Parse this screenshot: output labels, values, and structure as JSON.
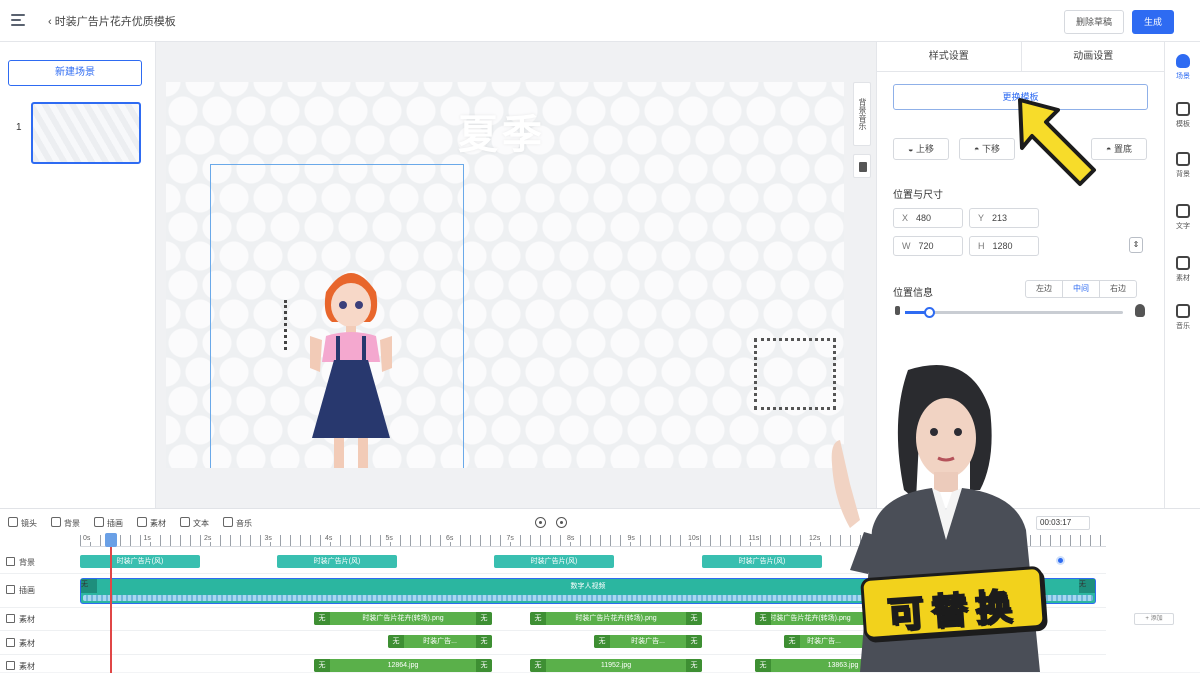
{
  "topbar": {
    "back_title": "时装广告片花卉优质模板",
    "exit_label": "删除草稿",
    "generate_label": "生成"
  },
  "left": {
    "new_scene": "新建场景",
    "scene_index": "1"
  },
  "canvas": {
    "title": "夏季",
    "side_tool": "背景音乐",
    "colors": {
      "accent": "#2e6bf2",
      "selection": "#6aa9e9"
    }
  },
  "panel": {
    "tabs": [
      "样式设置",
      "动画设置"
    ],
    "replace_label": "更换模板",
    "layer": {
      "up": "上移",
      "down": "下移",
      "bottom": "置底"
    },
    "pos_size_title": "位置与尺寸",
    "x_label": "X",
    "x_value": "480",
    "y_label": "Y",
    "y_value": "213",
    "w_label": "W",
    "w_value": "720",
    "h_label": "H",
    "h_value": "1280",
    "position_title": "位置信息",
    "align": {
      "left": "左边",
      "center": "中间",
      "right": "右边"
    },
    "slider_level": 0.11
  },
  "rail": [
    {
      "label": "场景",
      "icon": "person-icon"
    },
    {
      "label": "模板",
      "icon": "template-icon"
    },
    {
      "label": "背景",
      "icon": "background-icon"
    },
    {
      "label": "文字",
      "icon": "text-icon"
    },
    {
      "label": "素材",
      "icon": "image-icon"
    },
    {
      "label": "音乐",
      "icon": "music-icon"
    }
  ],
  "timeline": {
    "tools": [
      "镜头",
      "背景",
      "插画",
      "素材",
      "文本",
      "音乐"
    ],
    "timecode": "00:03:17",
    "ruler": [
      "0s",
      "1s",
      "2s",
      "3s",
      "4s",
      "5s",
      "6s",
      "7s",
      "8s",
      "9s",
      "10s",
      "11s",
      "12s"
    ],
    "tracks": [
      "背景",
      "插画",
      "素材",
      "素材",
      "素材"
    ],
    "bg_clips": [
      "时装广告片(风)",
      "时装广告片(风)",
      "时装广告片(风)",
      "时装广告片(风)"
    ],
    "avatar_label": "数字人视频",
    "cap_label": "无",
    "mat1_clips": [
      "时装广告片花卉(转场).png",
      "时装广告片花卉(转场).png",
      "时装广告片花卉(转场).png"
    ],
    "mat2_clips": [
      "时装广告...",
      "时装广告...",
      "时装广告..."
    ],
    "mat3_clips": [
      "12864.jpg",
      "11952.jpg",
      "13863.jpg"
    ],
    "mini_label": "+ 添加"
  },
  "badge": "可替换"
}
